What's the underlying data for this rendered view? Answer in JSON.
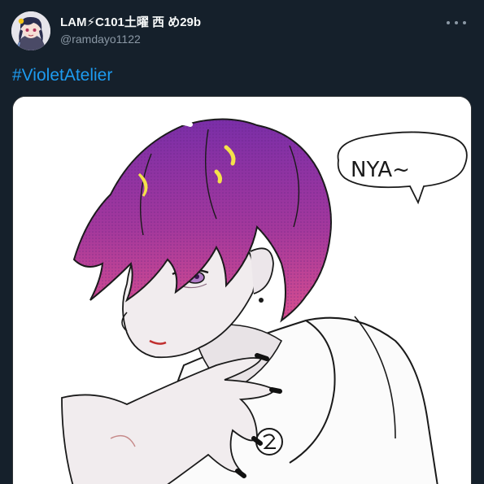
{
  "tweet": {
    "author": {
      "display_name": "LAM⚡C101土曜 西 め29b",
      "handle": "@ramdayo1122",
      "avatar_icon": "user-avatar"
    },
    "text": {
      "hashtag": "#VioletAtelier"
    },
    "media": {
      "kind": "illustration",
      "speech_bubble_text": "NYA~"
    },
    "more_icon": "more-horizontal-icon"
  },
  "colors": {
    "background": "#15202b",
    "name": "#f7f9f9",
    "handle": "#8b98a5",
    "hashtag": "#1d9bf0",
    "hair": "#7b2fa8",
    "hair_tips": "#d44a8c"
  }
}
